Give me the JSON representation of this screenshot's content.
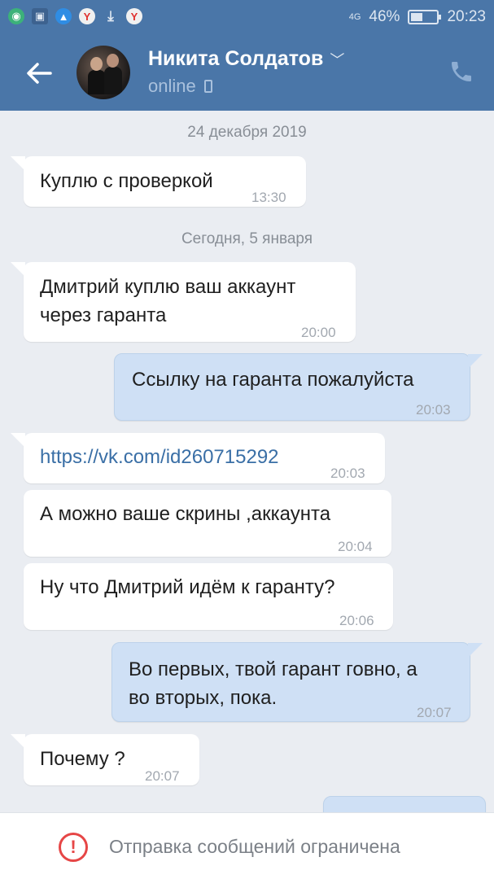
{
  "status_bar": {
    "left_icons": [
      "chat-bubble-icon",
      "gallery-icon",
      "warning-triangle-icon",
      "yandex-icon",
      "download-icon",
      "yandex-icon"
    ],
    "network": "4G",
    "battery": "46%",
    "battery_level": 0.46,
    "time": "20:23"
  },
  "header": {
    "contact_name": "Никита Солдатов",
    "status": "online"
  },
  "chat": {
    "date_1": "24 декабря 2019",
    "date_2": "Сегодня, 5 января",
    "messages": [
      {
        "direction": "in",
        "lines": [
          "Куплю с проверкой"
        ],
        "time": "13:30"
      },
      {
        "direction": "in",
        "lines": [
          "Дмитрий куплю ваш аккаунт",
          "через гаранта"
        ],
        "time": "20:00"
      },
      {
        "direction": "out",
        "lines": [
          "Ссылку на гаранта пожалуйста"
        ],
        "time": "20:03"
      },
      {
        "direction": "in",
        "lines": [
          "https://vk.com/id260715292"
        ],
        "time": "20:03"
      },
      {
        "direction": "in",
        "lines": [
          "А можно ваше скрины ,аккаунта"
        ],
        "time": "20:04"
      },
      {
        "direction": "in",
        "lines": [
          "Ну что Дмитрий идём к гаранту?"
        ],
        "time": "20:06"
      },
      {
        "direction": "out",
        "lines": [
          "Во первых, твой гарант говно, а",
          "во вторых, пока."
        ],
        "time": "20:07"
      },
      {
        "direction": "in",
        "lines": [
          "Почему ?"
        ],
        "time": "20:07"
      }
    ]
  },
  "footer": {
    "notice": "Отправка сообщений ограничена"
  },
  "colors": {
    "header_bg": "#4a76a8",
    "chat_bg": "#eaedf2",
    "outgoing_bubble": "#cfe0f5",
    "incoming_bubble": "#ffffff",
    "warning": "#e64646"
  }
}
